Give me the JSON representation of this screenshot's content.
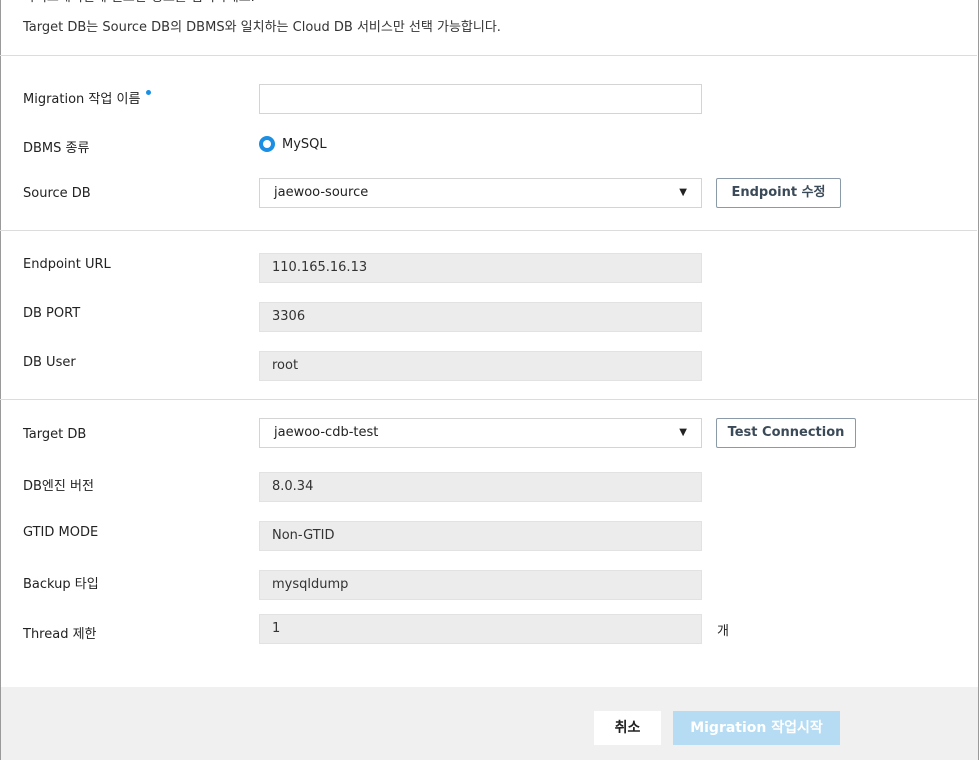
{
  "notice": {
    "line1": "마이그레이션에 필요한 정보를 입력하세요.",
    "line2": "Target DB는 Source DB의 DBMS와 일치하는 Cloud DB 서비스만 선택 가능합니다."
  },
  "form": {
    "migration_name": {
      "label": "Migration 작업 이름",
      "value": "",
      "placeholder": ""
    },
    "dbms_type": {
      "label": "DBMS 종류",
      "option": "MySQL"
    },
    "source_db": {
      "label": "Source DB",
      "value": "jaewoo-source",
      "button": "Endpoint 수정"
    },
    "endpoint_url": {
      "label": "Endpoint URL",
      "value": "110.165.16.13"
    },
    "db_port": {
      "label": "DB PORT",
      "value": "3306"
    },
    "db_user": {
      "label": "DB User",
      "value": "root"
    },
    "target_db": {
      "label": "Target DB",
      "value": "jaewoo-cdb-test",
      "button": "Test Connection"
    },
    "engine_version": {
      "label": "DB엔진 버전",
      "value": "8.0.34"
    },
    "gtid_mode": {
      "label": "GTID MODE",
      "value": "Non-GTID"
    },
    "backup_type": {
      "label": "Backup 타입",
      "value": "mysqldump"
    },
    "thread_limit": {
      "label": "Thread 제한",
      "value": "1",
      "unit": "개"
    }
  },
  "footer": {
    "cancel_label": "취소",
    "start_label": "Migration 작업시작"
  },
  "colors": {
    "accent": "#1a8fe3",
    "start_button_disabled": "#b5dcf3",
    "readonly_bg": "#ececec",
    "footer_bg": "#f0f0f0"
  }
}
